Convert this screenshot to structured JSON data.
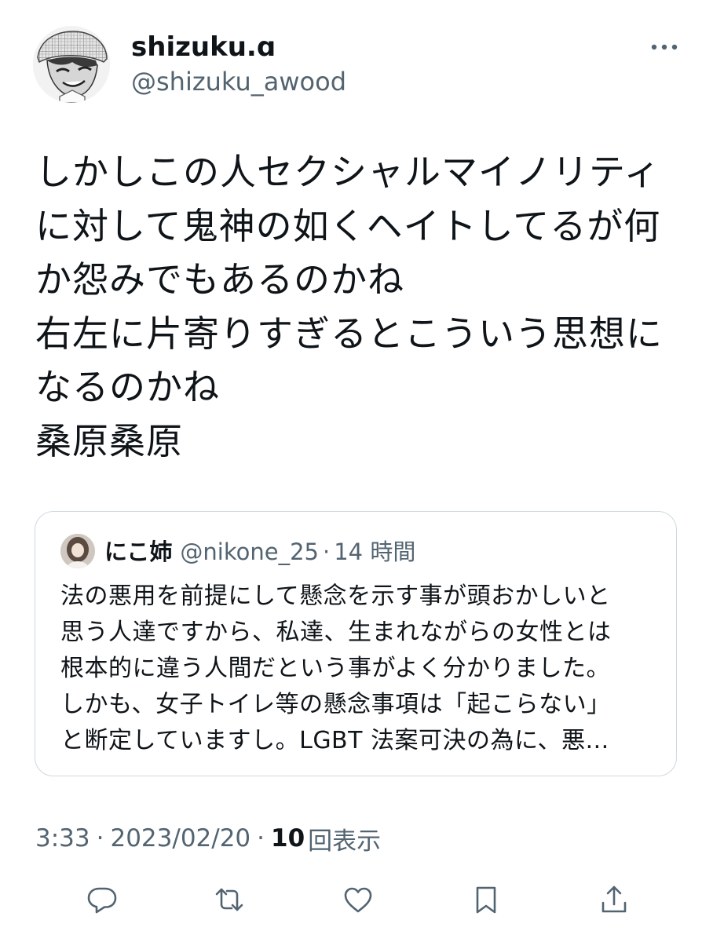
{
  "author": {
    "display_name": "shizuku.ɑ",
    "handle": "@shizuku_awood",
    "avatar_icon": "manga-character-avatar-icon"
  },
  "tweet": {
    "lines": [
      "しかしこの人セクシャルマイノリティ",
      "に対して鬼神の如くヘイトしてるが何",
      "か怨みでもあるのかね",
      "右左に片寄りすぎるとこういう思想に",
      "なるのかね",
      "桑原桑原"
    ]
  },
  "quoted_tweet": {
    "display_name": "にこ姉",
    "handle": "@nikone_25",
    "separator": "·",
    "time": "14 時間",
    "lines": [
      "法の悪用を前提にして懸念を示す事が頭おかしいと",
      "思う人達ですから、私達、生まれながらの女性とは",
      "根本的に違う人間だという事がよく分かりました。",
      "しかも、女子トイレ等の懸念事項は「起こらない」",
      "と断定していますし。LGBT 法案可決の為に、悪..."
    ]
  },
  "meta": {
    "time": "3:33",
    "separator": "·",
    "date": "2023/02/20",
    "views_count": "10",
    "views_label": "回表示"
  },
  "actions": {
    "reply_icon": "reply-icon",
    "retweet_icon": "retweet-icon",
    "like_icon": "heart-icon",
    "bookmark_icon": "bookmark-icon",
    "share_icon": "share-icon",
    "more_icon": "more-horizontal-icon"
  },
  "colors": {
    "text_primary": "#0f1419",
    "text_secondary": "#536471",
    "border": "#cfd9de",
    "background": "#ffffff"
  }
}
